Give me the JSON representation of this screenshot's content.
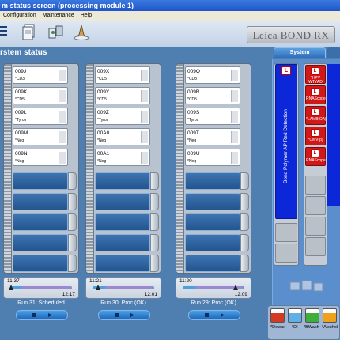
{
  "window": {
    "title": "m status screen (processing module 1)"
  },
  "menu": [
    "Configuration",
    "Maintenance",
    "Help"
  ],
  "brand": "Leica BOND RX",
  "section": "rstem status",
  "tabs": {
    "system": "System"
  },
  "racks": [
    {
      "slides": [
        {
          "id": "009J",
          "marker": "*CD3"
        },
        {
          "id": "009K",
          "marker": "*CD5"
        },
        {
          "id": "009L",
          "marker": "*Tyros"
        },
        {
          "id": "009M",
          "marker": "*Neg"
        },
        {
          "id": "009N",
          "marker": "*Neg"
        }
      ],
      "start": "11:37",
      "end": "12:17",
      "run": "Run 31: Scheduled"
    },
    {
      "slides": [
        {
          "id": "009X",
          "marker": "*CD5"
        },
        {
          "id": "009Y",
          "marker": "*CD5"
        },
        {
          "id": "009Z",
          "marker": "*Tyros"
        },
        {
          "id": "00A0",
          "marker": "*Neg"
        },
        {
          "id": "00A1",
          "marker": "*Neg"
        }
      ],
      "start": "11:21",
      "end": "12:01",
      "run": "Run 30: Proc (OK)"
    },
    {
      "slides": [
        {
          "id": "009Q",
          "marker": "*CD3"
        },
        {
          "id": "009R",
          "marker": "*CD5"
        },
        {
          "id": "009S",
          "marker": "*Tyros"
        },
        {
          "id": "009T",
          "marker": "*Neg"
        },
        {
          "id": "009U",
          "marker": "*Neg"
        }
      ],
      "start": "11:20",
      "end": "12:09",
      "run": "Run 29: Proc (OK)"
    }
  ],
  "reagents": {
    "detection": "Bond Polymer AP Red Detection",
    "logo": "L",
    "vials": [
      "*HPV WTYAD",
      "RNAScope",
      "*LAMB|OA|S",
      "*CMV(p)",
      "RNAScope"
    ]
  },
  "bulk": {
    "labels": [
      "*Dewax",
      "*DI",
      "*BWash",
      "*Alcohol"
    ]
  },
  "colors": {
    "accent": "#4f7fb0",
    "red": "#d01818",
    "blue": "#0b27d8"
  }
}
